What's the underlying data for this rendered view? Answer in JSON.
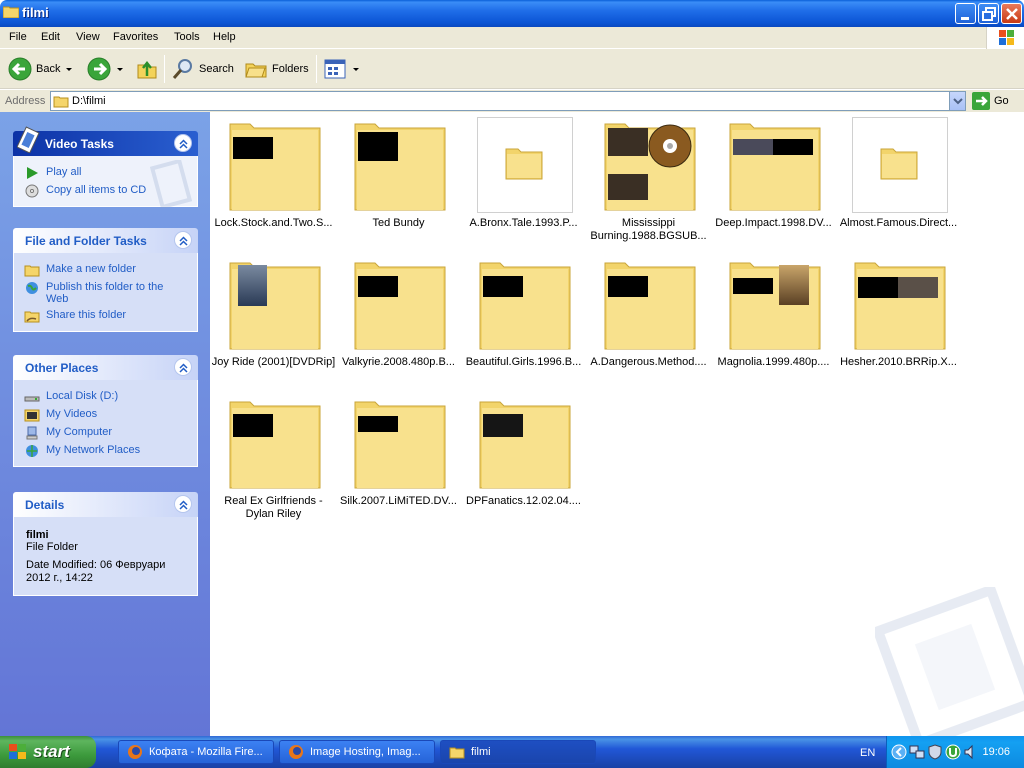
{
  "window": {
    "title": "filmi"
  },
  "menu": [
    "File",
    "Edit",
    "View",
    "Favorites",
    "Tools",
    "Help"
  ],
  "toolbar": {
    "back": "Back",
    "search": "Search",
    "folders": "Folders"
  },
  "address": {
    "label": "Address",
    "value": "D:\\filmi",
    "go": "Go"
  },
  "video_tasks": {
    "title": "Video Tasks",
    "items": [
      "Play all",
      "Copy all items to CD"
    ]
  },
  "file_tasks": {
    "title": "File and Folder Tasks",
    "items": [
      "Make a new folder",
      "Publish this folder to the Web",
      "Share this folder"
    ]
  },
  "other_places": {
    "title": "Other Places",
    "items": [
      "Local Disk (D:)",
      "My Videos",
      "My Computer",
      "My Network Places"
    ]
  },
  "details": {
    "title": "Details",
    "name": "filmi",
    "type": "File Folder",
    "modified": "Date Modified: 06 Февруари 2012 г., 14:22"
  },
  "items": [
    "Lock.Stock.and.Two.S...",
    "Ted Bundy",
    "A.Bronx.Tale.1993.P...",
    "Mississippi Burning.1988.BGSUB...",
    "Deep.Impact.1998.DV...",
    "Almost.Famous.Direct...",
    "Joy Ride (2001)[DVDRip]",
    "Valkyrie.2008.480p.B...",
    "Beautiful.Girls.1996.B...",
    "A.Dangerous.Method....",
    "Magnolia.1999.480p....",
    "Hesher.2010.BRRip.X...",
    "Real Ex Girlfriends - Dylan Riley",
    "Silk.2007.LiMiTED.DV...",
    "DPFanatics.12.02.04...."
  ],
  "taskbar": {
    "start": "start",
    "tasks": [
      "Кофата - Mozilla Fire...",
      "Image Hosting, Imag...",
      "filmi"
    ],
    "lang": "EN",
    "time": "19:06"
  }
}
